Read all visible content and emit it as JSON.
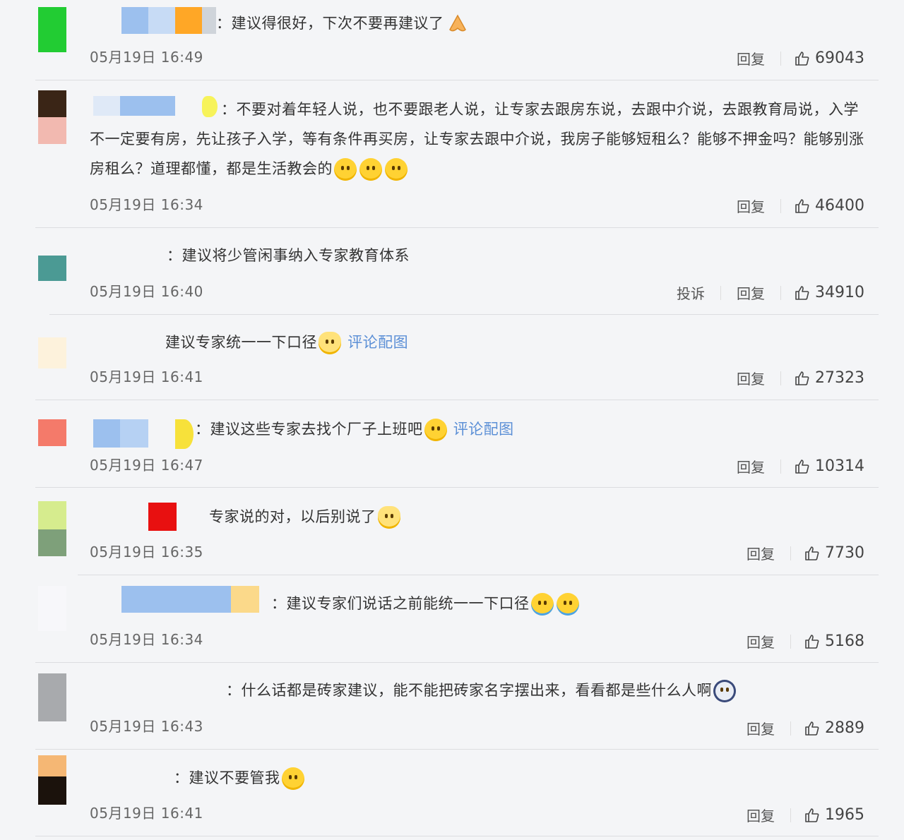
{
  "comments": [
    {
      "text": "：建议得很好，下次不要再建议了",
      "time": "05月19日 16:49",
      "reply": "回复",
      "likes": "69043"
    },
    {
      "text": "：不要对着年轻人说，也不要跟老人说，让专家去跟房东说，去跟中介说，去跟教育局说，入学不一定要有房，先让孩子入学，等有条件再买房，让专家去跟中介说，我房子能够短租么？能够不押金吗？能够别涨房租么？道理都懂，都是生活教会的",
      "time": "05月19日 16:34",
      "reply": "回复",
      "likes": "46400"
    },
    {
      "text": "：建议将少管闲事纳入专家教育体系",
      "time": "05月19日 16:40",
      "report": "投诉",
      "reply": "回复",
      "likes": "34910"
    },
    {
      "text": "建议专家统一一下口径",
      "link": "评论配图",
      "time": "05月19日 16:41",
      "reply": "回复",
      "likes": "27323"
    },
    {
      "text": "：建议这些专家去找个厂子上班吧",
      "link": "评论配图",
      "time": "05月19日 16:47",
      "reply": "回复",
      "likes": "10314"
    },
    {
      "text": "专家说的对，以后别说了",
      "time": "05月19日 16:35",
      "reply": "回复",
      "likes": "7730"
    },
    {
      "text": "：建议专家们说话之前能统一一下口径",
      "time": "05月19日 16:34",
      "reply": "回复",
      "likes": "5168"
    },
    {
      "text": "：什么话都是砖家建议，能不能把砖家名字摆出来，看看都是些什么人啊",
      "time": "05月19日 16:43",
      "reply": "回复",
      "likes": "2889"
    },
    {
      "text": "：建议不要管我",
      "time": "05月19日 16:41",
      "reply": "回复",
      "likes": "1965"
    }
  ],
  "colors": {
    "background": "#f4f5f7",
    "link": "#5b8fd6",
    "divider": "#dcdde0"
  }
}
